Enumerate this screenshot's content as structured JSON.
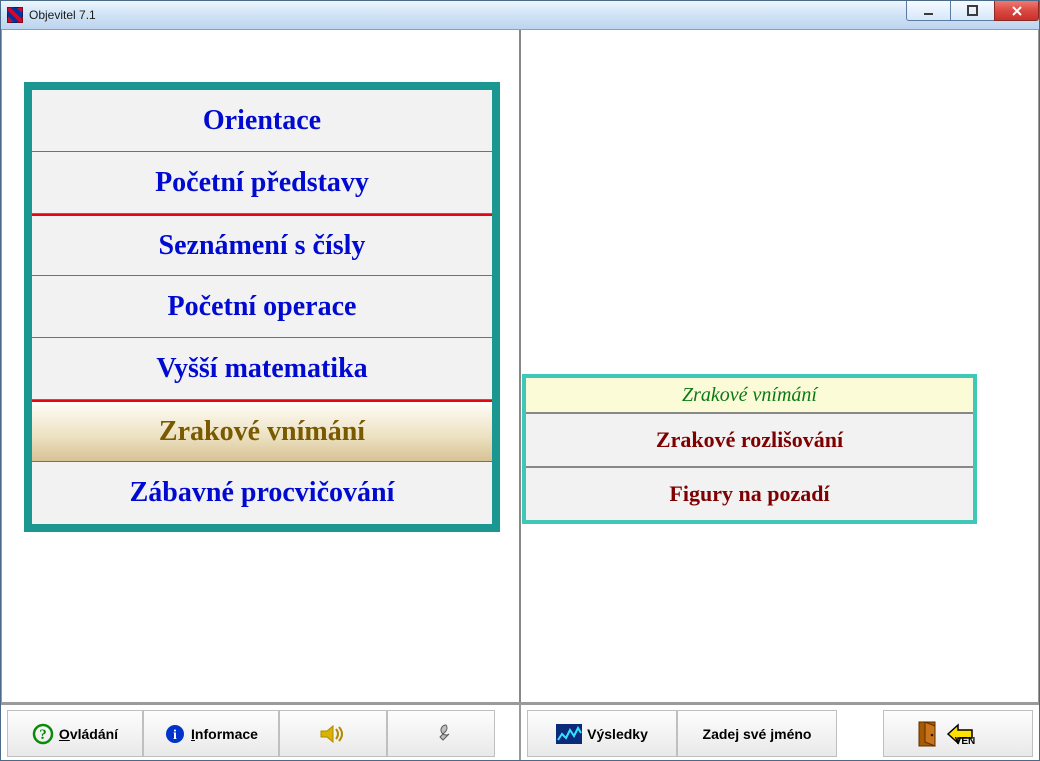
{
  "window": {
    "title": "Objevitel 7.1"
  },
  "menu": {
    "items": [
      {
        "label": "Orientace"
      },
      {
        "label": "Početní představy"
      },
      {
        "label": "Seznámení s čísly"
      },
      {
        "label": "Početní operace"
      },
      {
        "label": "Vyšší matematika"
      },
      {
        "label": "Zrakové vnímání",
        "selected": true
      },
      {
        "label": "Zábavné procvičování"
      }
    ]
  },
  "submenu": {
    "title": "Zrakové vnímání",
    "items": [
      {
        "label": "Zrakové rozlišování"
      },
      {
        "label": "Figury na pozadí"
      }
    ]
  },
  "bottom": {
    "ovladani": "Ovládání",
    "informace": "Informace",
    "vysledky": "Výsledky",
    "zadej_jmeno": "Zadej své jméno",
    "ven": "VEN"
  }
}
